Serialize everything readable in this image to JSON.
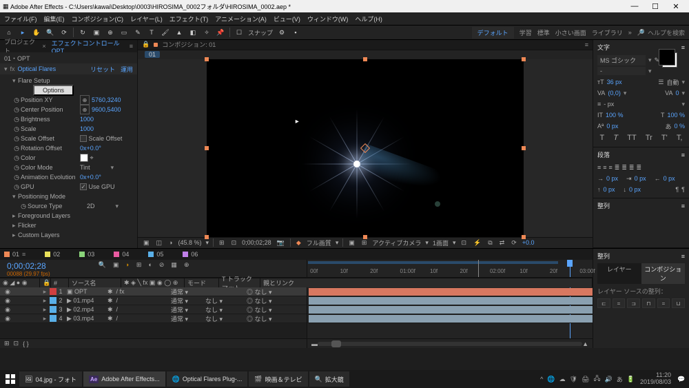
{
  "titlebar": {
    "title": "Adobe After Effects - C:\\Users\\kawai\\Desktop\\0003\\HIROSIMA_0002フォルダ\\HIROSIMA_0002.aep *"
  },
  "menubar": [
    "ファイル(F)",
    "編集(E)",
    "コンポジション(C)",
    "レイヤー(L)",
    "エフェクト(T)",
    "アニメーション(A)",
    "ビュー(V)",
    "ウィンドウ(W)",
    "ヘルプ(H)"
  ],
  "toolbar": {
    "snapping": "スナップ",
    "workspace_default": "デフォルト",
    "ws_items": [
      "学習",
      "標準",
      "小さい画面",
      "ライブラリ"
    ],
    "search_placeholder": "ヘルプを検索"
  },
  "left_panel": {
    "tab_project": "プロジェクト",
    "tab_effect": "エフェクトコントロール OPT",
    "layer_name": "01・OPT",
    "effect_name": "Optical Flares",
    "reset": "リセット",
    "about": "運用",
    "flare_setup": "Flare Setup",
    "options_btn": "Options",
    "props": {
      "position_xy": {
        "label": "Position XY",
        "value": "5760,3240"
      },
      "center_position": {
        "label": "Center Position",
        "value": "9600,5400"
      },
      "brightness": {
        "label": "Brightness",
        "value": "1000"
      },
      "scale": {
        "label": "Scale",
        "value": "1000"
      },
      "scale_offset": {
        "label": "Scale Offset",
        "checkbox_label": "Scale Offset"
      },
      "rotation_offset": {
        "label": "Rotation Offset",
        "value": "0x+0.0°"
      },
      "color": {
        "label": "Color"
      },
      "color_mode": {
        "label": "Color Mode",
        "value": "Tint"
      },
      "animation_evolution": {
        "label": "Animation Evolution",
        "value": "0x+0.0°"
      },
      "gpu": {
        "label": "GPU",
        "checkbox_label": "Use GPU",
        "checked": true
      }
    },
    "groups": [
      "Positioning Mode",
      "Foreground Layers",
      "Flicker",
      "Custom Layers"
    ],
    "source_type": {
      "label": "Source Type",
      "value": "2D"
    }
  },
  "comp_tabs": {
    "label": "コンポジション: 01",
    "breadcrumb": "01"
  },
  "viewer_bar": {
    "zoom": "(45.8 %)",
    "res": "フル画質",
    "camera": "アクティブカメラ",
    "views": "1画面",
    "timecode": "0;00;02;28",
    "exposure": "+0.0"
  },
  "right_panel": {
    "char_tab": "文字",
    "font": "MS ゴシック",
    "size": "36 px",
    "leading_auto": "自動",
    "kerning_label": "VA",
    "kerning_val": "(0,0)",
    "tracking": "0",
    "stroke_px": "- px",
    "scale_v": "100 %",
    "scale_h": "100 %",
    "baseline": "0 px",
    "tsume": "0 %",
    "styles": [
      "T",
      "T",
      "TT",
      "Tr",
      "T'",
      "T,"
    ],
    "para_tab": "段落",
    "indent_vals": [
      "0 px",
      "0 px",
      "0 px",
      "0 px",
      "0 px"
    ],
    "align_tab": "整列"
  },
  "timeline": {
    "tabs": [
      {
        "name": "01",
        "color": "#e85"
      },
      {
        "name": "02",
        "color": "#e8e05a"
      },
      {
        "name": "03",
        "color": "#8ad47a"
      },
      {
        "name": "04",
        "color": "#e85aa0"
      },
      {
        "name": "05",
        "color": "#5ab0e8"
      },
      {
        "name": "06",
        "color": "#c080e8"
      }
    ],
    "timecode": "0;00;02;28",
    "sub_timecode": "00088 (29.97 fps)",
    "cols": {
      "source": "ソース名",
      "mode": "モード",
      "trkmat": "T トラックマット",
      "parent": "親とリンク"
    },
    "ruler": [
      "00f",
      "10f",
      "20f",
      "01:00f",
      "10f",
      "20f",
      "02:00f",
      "10f",
      "20f",
      "03:00f"
    ],
    "layers": [
      {
        "num": "1",
        "name": "OPT",
        "color": "#d04040",
        "selected": true
      },
      {
        "num": "2",
        "name": "01.mp4",
        "color": "#5ab0e8"
      },
      {
        "num": "3",
        "name": "02.mp4",
        "color": "#5ab0e8"
      },
      {
        "num": "4",
        "name": "03.mp4",
        "color": "#5ab0e8"
      }
    ],
    "mode_normal": "通常",
    "trkmat_none": "なし",
    "parent_none": "なし",
    "right_panel": {
      "tabs": [
        "レイヤー",
        "コンポジション"
      ],
      "row": "レイヤー ソースの整列："
    }
  },
  "taskbar": {
    "items": [
      {
        "label": "04.jpg - フォト",
        "icon": "🖼"
      },
      {
        "label": "Adobe After Effects...",
        "icon": "Ae",
        "active": true
      },
      {
        "label": "Optical Flares Plug-...",
        "icon": "🌐"
      },
      {
        "label": "映画＆テレビ",
        "icon": "🎬"
      },
      {
        "label": "拡大鏡",
        "icon": "🔍"
      }
    ],
    "clock_time": "11:20",
    "clock_date": "2019/08/03"
  }
}
